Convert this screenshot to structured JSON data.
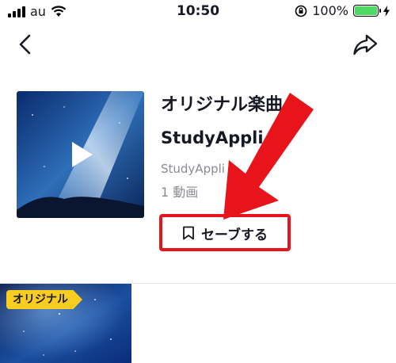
{
  "status_bar": {
    "carrier": "au",
    "time": "10:50",
    "battery_percent": "100%",
    "battery_level": 1.0,
    "icons": [
      "signal-icon",
      "wifi-icon",
      "rotation-lock-icon",
      "battery-icon",
      "charging-icon"
    ]
  },
  "nav": {
    "back_icon": "chevron-left-icon",
    "share_icon": "share-arrow-icon"
  },
  "sound": {
    "title": "オリジナル楽曲",
    "author": "StudyAppli",
    "author_sub": "StudyAppli",
    "video_count": "1 動画",
    "cover_icon": "play-icon"
  },
  "save_button": {
    "icon": "bookmark-icon",
    "label": "セーブする"
  },
  "annotation": {
    "arrow_color": "#e8141b",
    "box_color": "#e8141b"
  },
  "videos": [
    {
      "badge": "オリジナル"
    }
  ]
}
